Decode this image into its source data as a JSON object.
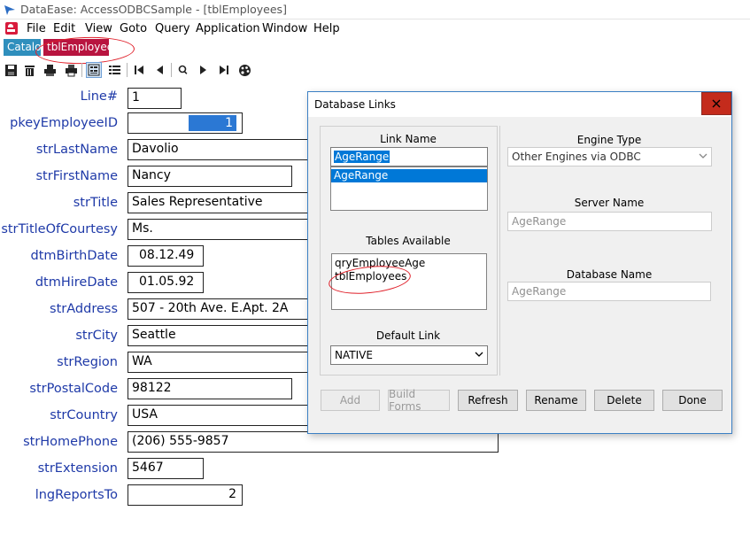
{
  "window": {
    "title": "DataEase: AccessODBCSample - [tblEmployees]"
  },
  "menu": [
    "File",
    "Edit",
    "View",
    "Goto",
    "Query",
    "Application",
    "Window",
    "Help"
  ],
  "tabs": {
    "catalog": "Catalog",
    "active": "tblEmployees"
  },
  "toolbar": {
    "buttons": [
      "save-icon",
      "delete-icon",
      "print-preview-icon",
      "print-icon",
      "form-view-icon",
      "list-view-icon",
      "first-record-icon",
      "previous-record-icon",
      "search-icon",
      "next-record-icon",
      "last-record-icon",
      "palette-icon"
    ]
  },
  "form": {
    "fields": [
      {
        "label": "Line#",
        "value": "1"
      },
      {
        "label": "pkeyEmployeeID",
        "value": "1"
      },
      {
        "label": "strLastName",
        "value": "Davolio"
      },
      {
        "label": "strFirstName",
        "value": "Nancy"
      },
      {
        "label": "strTitle",
        "value": "Sales Representative"
      },
      {
        "label": "strTitleOfCourtesy",
        "value": "Ms."
      },
      {
        "label": "dtmBirthDate",
        "value": "08.12.49"
      },
      {
        "label": "dtmHireDate",
        "value": "01.05.92"
      },
      {
        "label": "strAddress",
        "value": "507 - 20th Ave. E.Apt. 2A"
      },
      {
        "label": "strCity",
        "value": "Seattle"
      },
      {
        "label": "strRegion",
        "value": "WA"
      },
      {
        "label": "strPostalCode",
        "value": "98122"
      },
      {
        "label": "strCountry",
        "value": "USA"
      },
      {
        "label": "strHomePhone",
        "value": "(206) 555-9857"
      },
      {
        "label": "strExtension",
        "value": "5467"
      },
      {
        "label": "lngReportsTo",
        "value": "2"
      }
    ]
  },
  "dialog": {
    "title": "Database Links",
    "link_name_label": "Link Name",
    "link_name_value": "AgeRange",
    "link_list": [
      "AgeRange"
    ],
    "tables_label": "Tables Available",
    "tables_list": [
      "qryEmployeeAge",
      "tblEmployees"
    ],
    "default_link_label": "Default Link",
    "default_link_value": "NATIVE",
    "engine_type_label": "Engine Type",
    "engine_type_value": "Other Engines via ODBC",
    "server_name_label": "Server Name",
    "server_name_placeholder": "AgeRange",
    "database_name_label": "Database Name",
    "database_name_placeholder": "AgeRange",
    "buttons": {
      "add": "Add",
      "build_forms": "Build Forms",
      "refresh": "Refresh",
      "rename": "Rename",
      "delete": "Delete",
      "done": "Done"
    }
  },
  "colors": {
    "label_blue": "#1f3aa8",
    "tab_active": "#b8143f",
    "tab_catalog": "#2f8fbd",
    "selection": "#0078d7",
    "close_red": "#c42b1c",
    "annotation_red": "#e0202a"
  }
}
